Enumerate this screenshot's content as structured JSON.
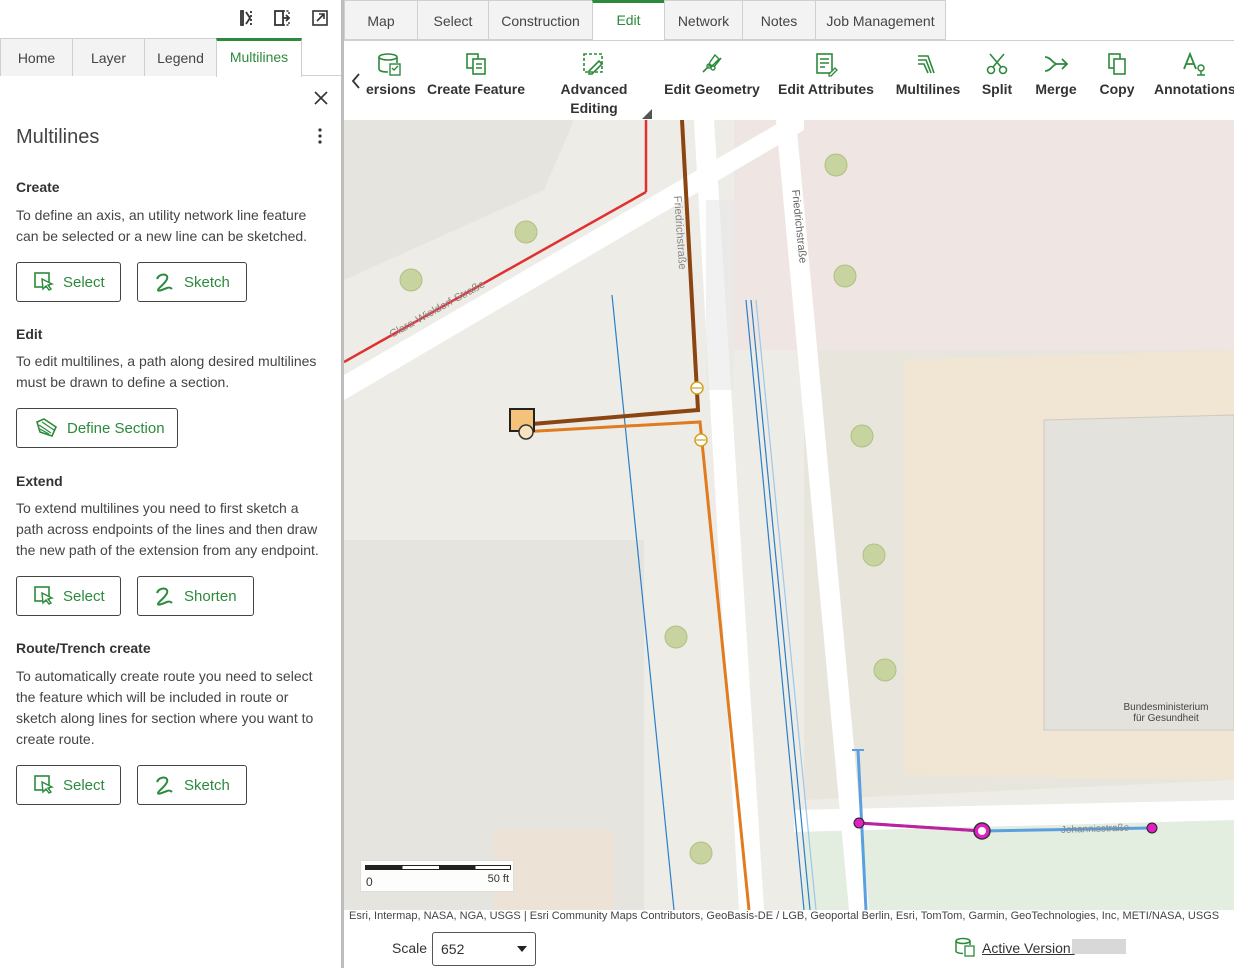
{
  "left_tabs": [
    "Home",
    "Layer",
    "Legend",
    "Multilines"
  ],
  "panel": {
    "title": "Multilines",
    "create": {
      "heading": "Create",
      "text": "To define an axis, an utility network line feature can be selected or a new line can be sketched.",
      "btn1": "Select",
      "btn2": "Sketch"
    },
    "edit": {
      "heading": "Edit",
      "text": "To edit multilines, a path along desired multilines must be drawn to define a section.",
      "btn1": "Define Section"
    },
    "extend": {
      "heading": "Extend",
      "text": "To extend multilines you need to first sketch a path across endpoints of the lines and then draw the new path of the extension from any endpoint.",
      "btn1": "Select",
      "btn2": "Shorten"
    },
    "route": {
      "heading": "Route/Trench create",
      "text": "To automatically create route you need to select the feature which will be included in route or sketch along lines for section where you want to create route.",
      "btn1": "Select",
      "btn2": "Sketch"
    }
  },
  "top_tabs": [
    "Map",
    "Select",
    "Construction",
    "Edit",
    "Network",
    "Notes",
    "Job Management"
  ],
  "ribbon": {
    "versions": "ersions",
    "create_feature": "Create Feature",
    "advanced_editing_1": "Advanced",
    "advanced_editing_2": "Editing",
    "edit_geometry": "Edit Geometry",
    "edit_attributes": "Edit Attributes",
    "multilines": "Multilines",
    "split": "Split",
    "merge": "Merge",
    "copy": "Copy",
    "annotations": "Annotations"
  },
  "map": {
    "street_clara": "Clara-Wieldorf-Straße",
    "street_friedrich_1": "Friedrichstraße",
    "street_friedrich_2": "Friedrichstraße",
    "street_johannis": "Johannisstraße",
    "building_label_1": "Bundesministerium",
    "building_label_2": "für Gesundheit",
    "scale_zero": "0",
    "scale_max": "50 ft",
    "attribution": "Esri, Intermap, NASA, NGA, USGS | Esri Community Maps Contributors, GeoBasis-DE / LGB, Geoportal Berlin, Esri, TomTom, Garmin, GeoTechnologies, Inc, METI/NASA, USGS"
  },
  "bottom": {
    "scale_label": "Scale",
    "scale_value": "652",
    "active_version_label": "Active Version:"
  },
  "colors": {
    "accent": "#2c8a3c",
    "red_line": "#e03030",
    "brown_line": "#8b4513",
    "orange_line": "#e07b20",
    "blue_line": "#2a7fc9",
    "magenta_line": "#c020a0"
  }
}
